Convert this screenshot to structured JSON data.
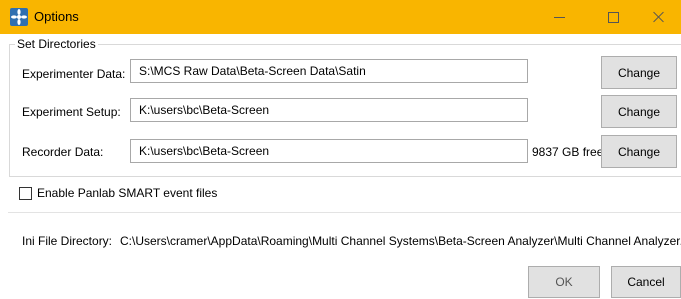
{
  "window": {
    "title": "Options",
    "icon": "app-logo-icon",
    "controls": [
      "minimize-icon",
      "maximize-icon",
      "close-icon"
    ],
    "title_bar_color": "#f9b500"
  },
  "set_directories": {
    "legend": "Set Directories",
    "rows": [
      {
        "label": "Experimenter Data:",
        "value": "S:\\MCS Raw Data\\Beta-Screen Data\\Satin",
        "button": "Change"
      },
      {
        "label": "Experiment Setup:",
        "value": "K:\\users\\bc\\Beta-Screen",
        "button": "Change"
      },
      {
        "label": "Recorder Data:",
        "value": "K:\\users\\bc\\Beta-Screen",
        "free_space": "9837 GB free",
        "button": "Change"
      }
    ]
  },
  "options": {
    "enable_smart_label": "Enable Panlab SMART event files",
    "enable_smart_checked": false
  },
  "ini": {
    "label": "Ini File Directory:",
    "value": "C:\\Users\\cramer\\AppData\\Roaming\\Multi Channel Systems\\Beta-Screen Analyzer\\Multi Channel Analyzer.ini"
  },
  "footer": {
    "ok_label": "OK",
    "cancel_label": "Cancel"
  }
}
